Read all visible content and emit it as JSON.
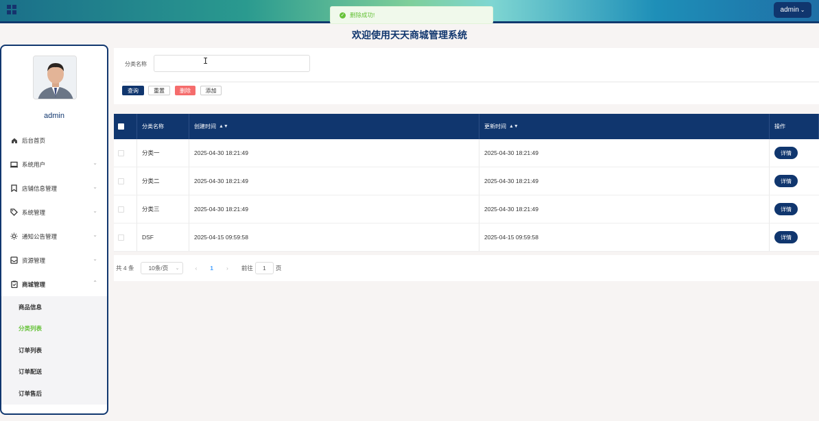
{
  "header": {
    "user_menu_label": "admin",
    "page_title": "欢迎使用天天商城管理系统"
  },
  "toast": {
    "message": "删除成功!"
  },
  "sidebar": {
    "username": "admin",
    "items": [
      {
        "label": "后台首页",
        "icon": "home-icon"
      },
      {
        "label": "系统用户",
        "icon": "monitor-icon"
      },
      {
        "label": "店铺信息管理",
        "icon": "bookmark-icon"
      },
      {
        "label": "系统管理",
        "icon": "tag-icon"
      },
      {
        "label": "通知公告管理",
        "icon": "sun-icon"
      },
      {
        "label": "资源管理",
        "icon": "inbox-icon"
      },
      {
        "label": "商城管理",
        "icon": "clipboard-check-icon"
      }
    ],
    "submenu": [
      {
        "label": "商品信息"
      },
      {
        "label": "分类列表",
        "active": true
      },
      {
        "label": "订单列表"
      },
      {
        "label": "订单配送"
      },
      {
        "label": "订单售后"
      }
    ]
  },
  "search": {
    "label": "分类名称",
    "value": "",
    "query_label": "查询",
    "reset_label": "重置",
    "delete_label": "删除",
    "add_label": "添加"
  },
  "table": {
    "headers": [
      "分类名称",
      "创建时间",
      "更新时间",
      "操作"
    ],
    "rows": [
      {
        "name": "分类一",
        "created": "2025-04-30 18:21:49",
        "updated": "2025-04-30 18:21:49",
        "action": "详情"
      },
      {
        "name": "分类二",
        "created": "2025-04-30 18:21:49",
        "updated": "2025-04-30 18:21:49",
        "action": "详情"
      },
      {
        "name": "分类三",
        "created": "2025-04-30 18:21:49",
        "updated": "2025-04-30 18:21:49",
        "action": "详情"
      },
      {
        "name": "DSF",
        "created": "2025-04-15 09:59:58",
        "updated": "2025-04-15 09:59:58",
        "action": "详情"
      }
    ]
  },
  "pagination": {
    "total": "共 4 条",
    "page_size": "10条/页",
    "current_page": "1",
    "goto_label": "前往",
    "goto_value": "1",
    "page_suffix": "页"
  },
  "colors": {
    "primary": "#10366e",
    "success": "#67c23a",
    "danger": "#f56c6c",
    "link": "#409eff"
  }
}
